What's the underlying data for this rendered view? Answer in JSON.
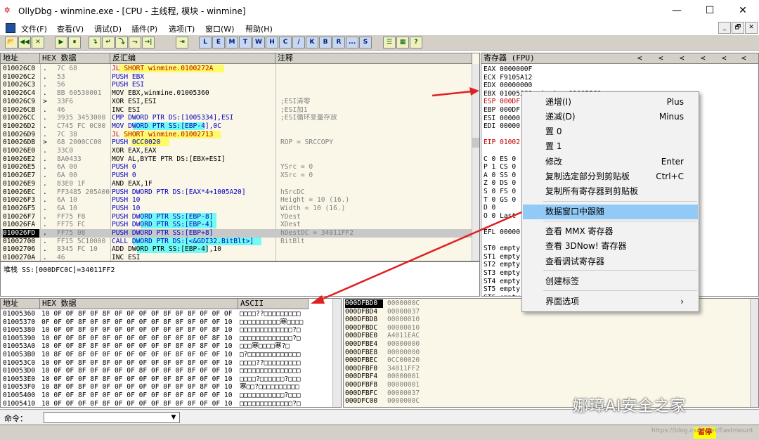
{
  "window": {
    "title": "OllyDbg - winmine.exe - [CPU - 主线程, 模块 - winmine]",
    "min": "—",
    "max": "☐",
    "close": "✕"
  },
  "menu": {
    "items": [
      "文件(F)",
      "查看(V)",
      "调试(D)",
      "插件(P)",
      "选项(T)",
      "窗口(W)",
      "帮助(H)"
    ],
    "mdi": [
      "_",
      "🗗",
      "✕"
    ]
  },
  "toolbar": {
    "buttons": [
      "📂",
      "◀◀",
      "✕",
      "▶",
      "⏸",
      "↴",
      "↵",
      "⤵",
      "⤳",
      "→|",
      "⇥",
      "L",
      "E",
      "M",
      "T",
      "W",
      "H",
      "C",
      "/",
      "K",
      "B",
      "R",
      "...",
      "S",
      "☰",
      "▦",
      "?"
    ]
  },
  "cpu": {
    "headers": {
      "addr": "地址",
      "hex": "HEX 数据",
      "disasm": "反汇编",
      "comment": "注释"
    },
    "rows": [
      {
        "addr": "010026C0",
        "m": ".",
        "hex": "7C 68",
        "asm": "JL SHORT winmine.0100272A",
        "c": ""
      },
      {
        "addr": "010026C2",
        "m": ".",
        "hex": "53",
        "asm": "PUSH EBX",
        "c": ""
      },
      {
        "addr": "010026C3",
        "m": ".",
        "hex": "56",
        "asm": "PUSH ESI",
        "c": ""
      },
      {
        "addr": "010026C4",
        "m": ".",
        "hex": "BB 60530001",
        "asm": "MOV EBX,winmine.01005360",
        "c": ""
      },
      {
        "addr": "010026C9",
        "m": ">",
        "hex": "33F6",
        "asm": "XOR ESI,ESI",
        "c": ";ESI清零"
      },
      {
        "addr": "010026CB",
        "m": ".",
        "hex": "46",
        "asm": "INC ESI",
        "c": ";ESI加1"
      },
      {
        "addr": "010026CC",
        "m": ".",
        "hex": "3935 3453000",
        "asm": "CMP DWORD PTR DS:[1005334],ESI",
        "c": ";ESI循环变量存放"
      },
      {
        "addr": "010026D2",
        "m": ".",
        "hex": "C745 FC 0C00",
        "asm": "MOV DWORD PTR SS:[EBP-4],0C",
        "c": ""
      },
      {
        "addr": "010026D9",
        "m": ".",
        "hex": "7C 38",
        "asm": "JL SHORT winmine.01002713",
        "c": ""
      },
      {
        "addr": "010026DB",
        "m": ">",
        "hex": "68 2000CC00",
        "asm": "PUSH 0CC0020",
        "c": "ROP = SRCCOPY"
      },
      {
        "addr": "010026E0",
        "m": ".",
        "hex": "33C0",
        "asm": "XOR EAX,EAX",
        "c": ""
      },
      {
        "addr": "010026E2",
        "m": ".",
        "hex": "8A0433",
        "asm": "MOV AL,BYTE PTR DS:[EBX+ESI]",
        "c": ""
      },
      {
        "addr": "010026E5",
        "m": ".",
        "hex": "6A 00",
        "asm": "PUSH 0",
        "c": "YSrc = 0"
      },
      {
        "addr": "010026E7",
        "m": ".",
        "hex": "6A 00",
        "asm": "PUSH 0",
        "c": "XSrc = 0"
      },
      {
        "addr": "010026E9",
        "m": ".",
        "hex": "83E0 1F",
        "asm": "AND EAX,1F",
        "c": ""
      },
      {
        "addr": "010026EC",
        "m": ".",
        "hex": "FF3485 205A00",
        "asm": "PUSH DWORD PTR DS:[EAX*4+1005A20]",
        "c": "hSrcDC"
      },
      {
        "addr": "010026F3",
        "m": ".",
        "hex": "6A 10",
        "asm": "PUSH 10",
        "c": "Height = 10 (16.)"
      },
      {
        "addr": "010026F5",
        "m": ".",
        "hex": "6A 10",
        "asm": "PUSH 10",
        "c": "Width = 10 (16.)"
      },
      {
        "addr": "010026F7",
        "m": ".",
        "hex": "FF75 F8",
        "asm": "PUSH DWORD PTR SS:[EBP-8]",
        "c": "YDest"
      },
      {
        "addr": "010026FA",
        "m": ".",
        "hex": "FF75 FC",
        "asm": "PUSH DWORD PTR SS:[EBP-4]",
        "c": "XDest"
      },
      {
        "addr": "010026FD",
        "m": ".",
        "hex": "FF75 08",
        "asm": "PUSH DWORD PTR SS:[EBP+8]",
        "c": "hDestDC = 34011FF2"
      },
      {
        "addr": "01002700",
        "m": ".",
        "hex": "FF15 5C10000",
        "asm": "CALL DWORD PTR DS:[<&GDI32.BitBlt>]",
        "c": "BitBlt"
      },
      {
        "addr": "01002706",
        "m": ".",
        "hex": "8345 FC 10",
        "asm": "ADD DWORD PTR SS:[EBP-4],10",
        "c": ""
      },
      {
        "addr": "0100270A",
        "m": ".",
        "hex": "46",
        "asm": "INC ESI",
        "c": ""
      }
    ],
    "stack_info": "堆栈 SS:[000DFC0C]=34011FF2"
  },
  "registers": {
    "header": "寄存器 (FPU)",
    "nav": [
      "<",
      "<",
      "<",
      "<",
      "<",
      "<"
    ],
    "lines": [
      "EAX 0000000F",
      "ECX F9105A12",
      "EDX 00000000",
      "EBX 01005360 winmine.01005360",
      "ESP 000DF",
      "EBP 000DF",
      "ESI 00000",
      "EDI 00000",
      "",
      "EIP 01002",
      "",
      "C 0  ES 0",
      "P 1  CS 0",
      "A 0  SS 0",
      "Z 0  DS 0",
      "S 0  FS 0",
      "T 0  GS 0",
      "D 0",
      "O 0  Last",
      "",
      "EFL 00000",
      "",
      "ST0 empty",
      "ST1 empty",
      "ST2 empty",
      "ST3 empty",
      "ST4 empty",
      "ST5 empty",
      "ST6 empty",
      "ST7 empty"
    ]
  },
  "context_menu": {
    "items": [
      {
        "label": "递增(I)",
        "shortcut": "Plus"
      },
      {
        "label": "递减(D)",
        "shortcut": "Minus"
      },
      {
        "label": "置 0",
        "shortcut": ""
      },
      {
        "label": "置 1",
        "shortcut": ""
      },
      {
        "label": "修改",
        "shortcut": "Enter"
      },
      {
        "label": "复制选定部分到剪贴板",
        "shortcut": "Ctrl+C"
      },
      {
        "label": "复制所有寄存器到剪贴板",
        "shortcut": ""
      },
      {
        "label": "数据窗口中跟随",
        "shortcut": ""
      },
      {
        "label": "查看 MMX 寄存器",
        "shortcut": ""
      },
      {
        "label": "查看 3DNow! 寄存器",
        "shortcut": ""
      },
      {
        "label": "查看调试寄存器",
        "shortcut": ""
      },
      {
        "label": "创建标签",
        "shortcut": ""
      },
      {
        "label": "界面选项",
        "shortcut": "›"
      }
    ]
  },
  "dump": {
    "headers": {
      "addr": "地址",
      "hex": "HEX 数据",
      "ascii": "ASCII"
    },
    "rows": [
      {
        "addr": "01005360",
        "hex": "10 0F 0F 8F 0F 8F 0F 0F 0F 0F 8F 0F 8F 0F 0F 0F",
        "asc": "□□□□??□□□□□□□□□"
      },
      {
        "addr": "01005370",
        "hex": "0F 0F 0F 8F 0F 0F 0F 0F 0F 0F 8F 0F 0F 0F 0F 10",
        "asc": "□□□□□□□□□□寒□□□□"
      },
      {
        "addr": "01005380",
        "hex": "10 0F 0F 8F 0F 0F 0F 0F 0F 0F 0F 0F 8F 0F 8F 10",
        "asc": "□□□□□□□□□□□□□?□"
      },
      {
        "addr": "01005390",
        "hex": "10 0F 0F 8F 0F 0F 0F 0F 0F 0F 0F 0F 8F 0F 8F 10",
        "asc": "□□□□□□□□□□□□□?□"
      },
      {
        "addr": "010053A0",
        "hex": "10 0F 0F 8F 8F 0F 0F 0F 0F 0F 0F 8F 0F 8F 0F 10",
        "asc": "□□□寒□□□□寒?□"
      },
      {
        "addr": "010053B0",
        "hex": "10 8F 0F 8F 0F 0F 0F 0F 0F 0F 0F 8F 0F 0F 0F 10",
        "asc": "□?□□□□□□□□□□□□□"
      },
      {
        "addr": "010053C0",
        "hex": "10 0F 0F 8F 0F 8F 0F 0F 0F 0F 0F 0F 8F 0F 0F 10",
        "asc": "□□□□??□□□□□□□□□"
      },
      {
        "addr": "010053D0",
        "hex": "10 0F 0F 8F 0F 0F 0F 0F 8F 0F 0F 0F 8F 0F 0F 10",
        "asc": "□□□□□□□□□□□□□□□"
      },
      {
        "addr": "010053E0",
        "hex": "10 0F 0F 0F 8F 8F 0F 0F 0F 0F 0F 8F 0F 0F 0F 10",
        "asc": "□□□□?□□□□□□?□□□"
      },
      {
        "addr": "010053F0",
        "hex": "10 8F 0F 8F 0F 0F 0F 0F 0F 0F 0F 0F 0F 8F 0F 10",
        "asc": "寒□□?□□□□□□□□□□"
      },
      {
        "addr": "01005400",
        "hex": "10 0F 0F 8F 0F 0F 0F 0F 0F 0F 0F 0F 8F 0F 0F 10",
        "asc": "□□□□□□□□□□□?□□□"
      },
      {
        "addr": "01005410",
        "hex": "10 0F 0F 0F 0F 8F 0F 0F 0F 0F 8F 0F 0F 0F 0F 10",
        "asc": "□□□□□□□□□□□□□?□"
      }
    ]
  },
  "stack": {
    "rows": [
      {
        "addr": "000DFBD0",
        "val": "0000000C"
      },
      {
        "addr": "000DFBD4",
        "val": "00000037"
      },
      {
        "addr": "000DFBD8",
        "val": "00000010"
      },
      {
        "addr": "000DFBDC",
        "val": "00000010"
      },
      {
        "addr": "000DFBE0",
        "val": "A4011EAC"
      },
      {
        "addr": "000DFBE4",
        "val": "00000000"
      },
      {
        "addr": "000DFBE8",
        "val": "00000000"
      },
      {
        "addr": "000DFBEC",
        "val": "0CC00020"
      },
      {
        "addr": "000DFBF0",
        "val": "34011FF2"
      },
      {
        "addr": "000DFBF4",
        "val": "00000001"
      },
      {
        "addr": "000DFBF8",
        "val": "00000001"
      },
      {
        "addr": "000DFBFC",
        "val": "00000037"
      },
      {
        "addr": "000DFC00",
        "val": "0000000C"
      }
    ]
  },
  "cmd": {
    "label": "命令：",
    "drop": "▼"
  },
  "status": {
    "paused": "暂停"
  },
  "watermark": {
    "text": "娜璋AI安全之家",
    "url": "https://blog.csdn.net/Eastmount"
  }
}
